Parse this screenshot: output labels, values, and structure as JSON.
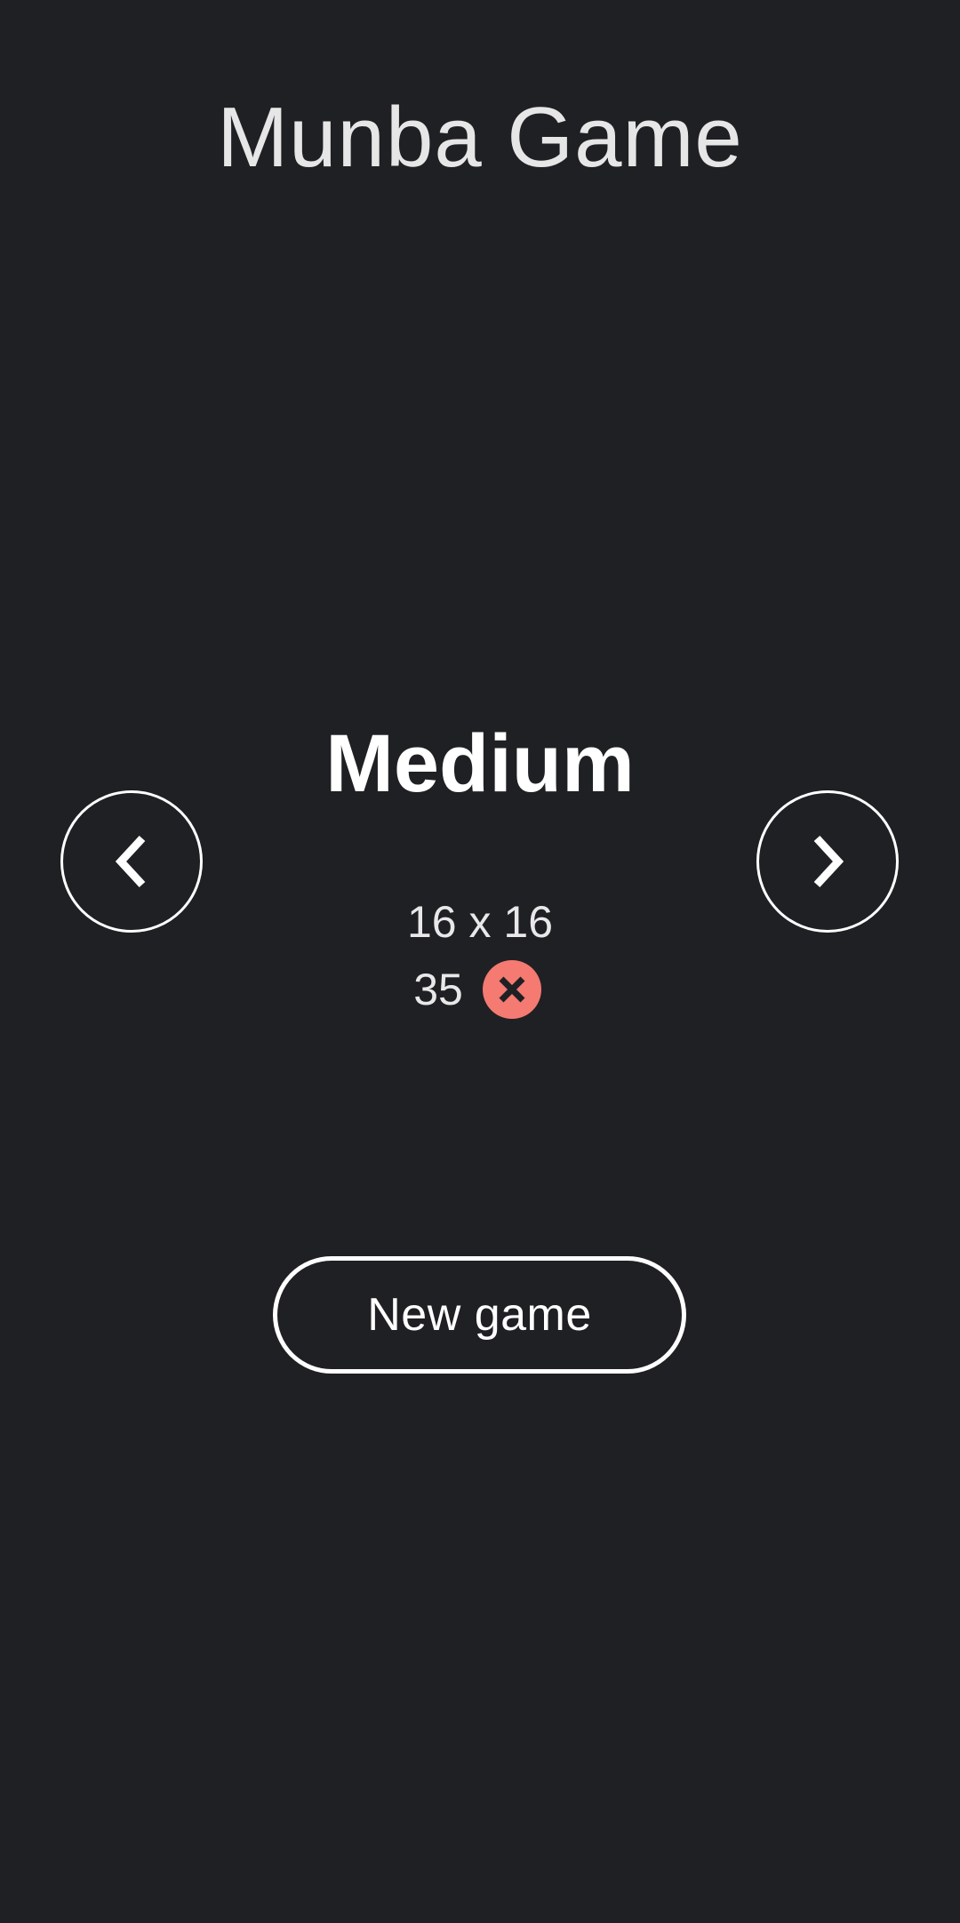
{
  "app": {
    "title": "Munba Game"
  },
  "level": {
    "name": "Medium",
    "board_size": "16 x 16",
    "mine_count": "35"
  },
  "icons": {
    "prev": "chevron-left-icon",
    "next": "chevron-right-icon",
    "mine": "close-circle-icon"
  },
  "colors": {
    "background": "#1f2024",
    "mine_badge": "#f47a72",
    "foreground": "#ffffff"
  },
  "actions": {
    "new_game_label": "New game"
  }
}
